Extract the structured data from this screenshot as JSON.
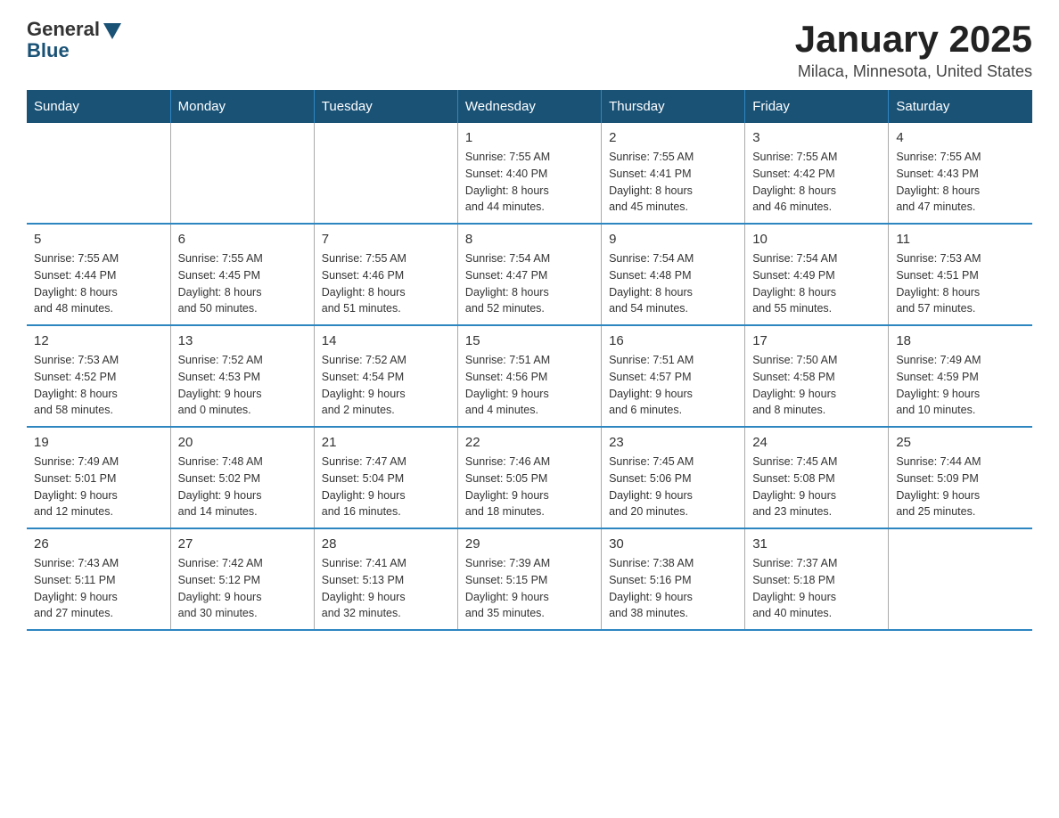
{
  "header": {
    "logo_general": "General",
    "logo_blue": "Blue",
    "month_title": "January 2025",
    "location": "Milaca, Minnesota, United States"
  },
  "weekdays": [
    "Sunday",
    "Monday",
    "Tuesday",
    "Wednesday",
    "Thursday",
    "Friday",
    "Saturday"
  ],
  "weeks": [
    [
      {
        "day": "",
        "info": ""
      },
      {
        "day": "",
        "info": ""
      },
      {
        "day": "",
        "info": ""
      },
      {
        "day": "1",
        "info": "Sunrise: 7:55 AM\nSunset: 4:40 PM\nDaylight: 8 hours\nand 44 minutes."
      },
      {
        "day": "2",
        "info": "Sunrise: 7:55 AM\nSunset: 4:41 PM\nDaylight: 8 hours\nand 45 minutes."
      },
      {
        "day": "3",
        "info": "Sunrise: 7:55 AM\nSunset: 4:42 PM\nDaylight: 8 hours\nand 46 minutes."
      },
      {
        "day": "4",
        "info": "Sunrise: 7:55 AM\nSunset: 4:43 PM\nDaylight: 8 hours\nand 47 minutes."
      }
    ],
    [
      {
        "day": "5",
        "info": "Sunrise: 7:55 AM\nSunset: 4:44 PM\nDaylight: 8 hours\nand 48 minutes."
      },
      {
        "day": "6",
        "info": "Sunrise: 7:55 AM\nSunset: 4:45 PM\nDaylight: 8 hours\nand 50 minutes."
      },
      {
        "day": "7",
        "info": "Sunrise: 7:55 AM\nSunset: 4:46 PM\nDaylight: 8 hours\nand 51 minutes."
      },
      {
        "day": "8",
        "info": "Sunrise: 7:54 AM\nSunset: 4:47 PM\nDaylight: 8 hours\nand 52 minutes."
      },
      {
        "day": "9",
        "info": "Sunrise: 7:54 AM\nSunset: 4:48 PM\nDaylight: 8 hours\nand 54 minutes."
      },
      {
        "day": "10",
        "info": "Sunrise: 7:54 AM\nSunset: 4:49 PM\nDaylight: 8 hours\nand 55 minutes."
      },
      {
        "day": "11",
        "info": "Sunrise: 7:53 AM\nSunset: 4:51 PM\nDaylight: 8 hours\nand 57 minutes."
      }
    ],
    [
      {
        "day": "12",
        "info": "Sunrise: 7:53 AM\nSunset: 4:52 PM\nDaylight: 8 hours\nand 58 minutes."
      },
      {
        "day": "13",
        "info": "Sunrise: 7:52 AM\nSunset: 4:53 PM\nDaylight: 9 hours\nand 0 minutes."
      },
      {
        "day": "14",
        "info": "Sunrise: 7:52 AM\nSunset: 4:54 PM\nDaylight: 9 hours\nand 2 minutes."
      },
      {
        "day": "15",
        "info": "Sunrise: 7:51 AM\nSunset: 4:56 PM\nDaylight: 9 hours\nand 4 minutes."
      },
      {
        "day": "16",
        "info": "Sunrise: 7:51 AM\nSunset: 4:57 PM\nDaylight: 9 hours\nand 6 minutes."
      },
      {
        "day": "17",
        "info": "Sunrise: 7:50 AM\nSunset: 4:58 PM\nDaylight: 9 hours\nand 8 minutes."
      },
      {
        "day": "18",
        "info": "Sunrise: 7:49 AM\nSunset: 4:59 PM\nDaylight: 9 hours\nand 10 minutes."
      }
    ],
    [
      {
        "day": "19",
        "info": "Sunrise: 7:49 AM\nSunset: 5:01 PM\nDaylight: 9 hours\nand 12 minutes."
      },
      {
        "day": "20",
        "info": "Sunrise: 7:48 AM\nSunset: 5:02 PM\nDaylight: 9 hours\nand 14 minutes."
      },
      {
        "day": "21",
        "info": "Sunrise: 7:47 AM\nSunset: 5:04 PM\nDaylight: 9 hours\nand 16 minutes."
      },
      {
        "day": "22",
        "info": "Sunrise: 7:46 AM\nSunset: 5:05 PM\nDaylight: 9 hours\nand 18 minutes."
      },
      {
        "day": "23",
        "info": "Sunrise: 7:45 AM\nSunset: 5:06 PM\nDaylight: 9 hours\nand 20 minutes."
      },
      {
        "day": "24",
        "info": "Sunrise: 7:45 AM\nSunset: 5:08 PM\nDaylight: 9 hours\nand 23 minutes."
      },
      {
        "day": "25",
        "info": "Sunrise: 7:44 AM\nSunset: 5:09 PM\nDaylight: 9 hours\nand 25 minutes."
      }
    ],
    [
      {
        "day": "26",
        "info": "Sunrise: 7:43 AM\nSunset: 5:11 PM\nDaylight: 9 hours\nand 27 minutes."
      },
      {
        "day": "27",
        "info": "Sunrise: 7:42 AM\nSunset: 5:12 PM\nDaylight: 9 hours\nand 30 minutes."
      },
      {
        "day": "28",
        "info": "Sunrise: 7:41 AM\nSunset: 5:13 PM\nDaylight: 9 hours\nand 32 minutes."
      },
      {
        "day": "29",
        "info": "Sunrise: 7:39 AM\nSunset: 5:15 PM\nDaylight: 9 hours\nand 35 minutes."
      },
      {
        "day": "30",
        "info": "Sunrise: 7:38 AM\nSunset: 5:16 PM\nDaylight: 9 hours\nand 38 minutes."
      },
      {
        "day": "31",
        "info": "Sunrise: 7:37 AM\nSunset: 5:18 PM\nDaylight: 9 hours\nand 40 minutes."
      },
      {
        "day": "",
        "info": ""
      }
    ]
  ]
}
